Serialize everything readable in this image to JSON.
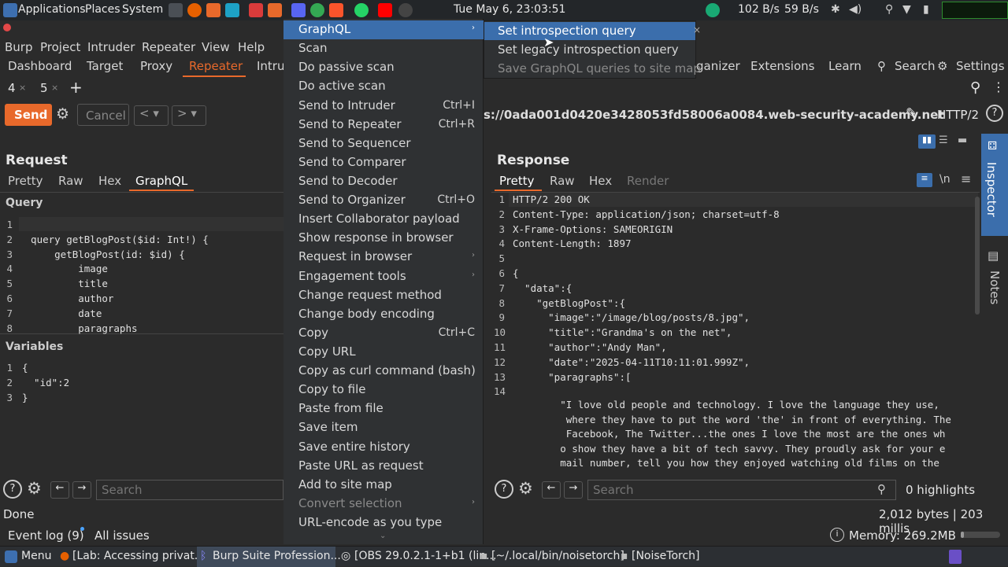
{
  "topbar": {
    "applications": "Applications",
    "places": "Places",
    "system": "System",
    "clock": "Tue May  6, 23:03:51",
    "net_down": "102 B/s",
    "net_up": "59 B/s"
  },
  "menubar": {
    "burp": "Burp",
    "project": "Project",
    "intruder": "Intruder",
    "repeater": "Repeater",
    "view": "View",
    "help": "Help"
  },
  "tabs": {
    "dashboard": "Dashboard",
    "target": "Target",
    "proxy": "Proxy",
    "repeater": "Repeater",
    "intru": "Intru",
    "organizer": "ganizer",
    "extensions": "Extensions",
    "learn": "Learn",
    "search": "Search",
    "settings": "Settings"
  },
  "subtabs": {
    "t4": "4",
    "t5": "5",
    "x": "×",
    "plus": "+"
  },
  "toolbar": {
    "send": "Send",
    "cancel": "Cancel",
    "url": "s://0ada001d0420e3428053fd58006a0084.web-security-academy.net",
    "http": "HTTP/2"
  },
  "request": {
    "title": "Request",
    "tabs": [
      "Pretty",
      "Raw",
      "Hex",
      "GraphQL"
    ],
    "query_label": "Query",
    "variables_label": "Variables",
    "query_lines": [
      "",
      "  query getBlogPost($id: Int!) {",
      "      getBlogPost(id: $id) {",
      "          image",
      "          title",
      "          author",
      "          date",
      "          paragraphs"
    ],
    "var_lines": [
      "{",
      "  \"id\":2",
      "}"
    ]
  },
  "response": {
    "title": "Response",
    "tabs": [
      "Pretty",
      "Raw",
      "Hex",
      "Render"
    ],
    "lines": [
      "HTTP/2 200 OK",
      "Content-Type: application/json; charset=utf-8",
      "X-Frame-Options: SAMEORIGIN",
      "Content-Length: 1897",
      "",
      "{",
      "  \"data\":{",
      "    \"getBlogPost\":{",
      "      \"image\":\"/image/blog/posts/8.jpg\",",
      "      \"title\":\"Grandma's on the net\",",
      "      \"author\":\"Andy Man\",",
      "      \"date\":\"2025-04-11T10:11:01.999Z\",",
      "      \"paragraphs\":[",
      ""
    ],
    "para": [
      "        \"I love old people and technology. I love the language they use,",
      "         where they have to put the word 'the' in front of everything. The",
      "         Facebook, The Twitter...the ones I love the most are the ones wh",
      "        o show they have a bit of tech savvy. They proudly ask for your e",
      "        mail number, tell you how they enjoyed watching old films on the"
    ],
    "highlights": "0 highlights",
    "size": "2,012 bytes | 203 millis"
  },
  "search_placeholder": "Search",
  "status": {
    "done": "Done",
    "event_log": "Event log (9)",
    "all_issues": "All issues",
    "memory": "Memory: 269.2MB"
  },
  "side": {
    "inspector": "Inspector",
    "notes": "Notes"
  },
  "context_menu": {
    "items": [
      {
        "label": "GraphQL",
        "shortcut": "",
        "arrow": true,
        "dim": false,
        "hl": true
      },
      {
        "label": "Scan",
        "shortcut": ""
      },
      {
        "label": "Do passive scan",
        "shortcut": ""
      },
      {
        "label": "Do active scan",
        "shortcut": ""
      },
      {
        "label": "Send to Intruder",
        "shortcut": "Ctrl+I"
      },
      {
        "label": "Send to Repeater",
        "shortcut": "Ctrl+R"
      },
      {
        "label": "Send to Sequencer",
        "shortcut": ""
      },
      {
        "label": "Send to Comparer",
        "shortcut": ""
      },
      {
        "label": "Send to Decoder",
        "shortcut": ""
      },
      {
        "label": "Send to Organizer",
        "shortcut": "Ctrl+O"
      },
      {
        "label": "Insert Collaborator payload",
        "shortcut": ""
      },
      {
        "label": "Show response in browser",
        "shortcut": ""
      },
      {
        "label": "Request in browser",
        "shortcut": "",
        "arrow": true
      },
      {
        "label": "Engagement tools",
        "shortcut": "",
        "arrow": true
      },
      {
        "label": "Change request method",
        "shortcut": ""
      },
      {
        "label": "Change body encoding",
        "shortcut": ""
      },
      {
        "label": "Copy",
        "shortcut": "Ctrl+C"
      },
      {
        "label": "Copy URL",
        "shortcut": ""
      },
      {
        "label": "Copy as curl command (bash)",
        "shortcut": ""
      },
      {
        "label": "Copy to file",
        "shortcut": ""
      },
      {
        "label": "Paste from file",
        "shortcut": ""
      },
      {
        "label": "Save item",
        "shortcut": ""
      },
      {
        "label": "Save entire history",
        "shortcut": ""
      },
      {
        "label": "Paste URL as request",
        "shortcut": ""
      },
      {
        "label": "Add to site map",
        "shortcut": ""
      },
      {
        "label": "Convert selection",
        "shortcut": "",
        "arrow": true,
        "dim": true
      },
      {
        "label": "URL-encode as you type",
        "shortcut": ""
      }
    ]
  },
  "submenu": {
    "items": [
      {
        "label": "Set introspection query",
        "dim": false
      },
      {
        "label": "Set legacy introspection query",
        "dim": false
      },
      {
        "label": "Save GraphQL queries to site map",
        "dim": true
      }
    ]
  },
  "taskbar": {
    "menu": "Menu",
    "items": [
      "[Lab: Accessing privat...",
      "Burp Suite Profession...",
      "[OBS 29.0.2.1-1+b1 (lin...",
      "[~/.local/bin/noisetorch]",
      "[NoiseTorch]"
    ]
  },
  "colors": {
    "accent": "#e8692b",
    "highlight": "#3b6eac",
    "bg": "#2b2b2b"
  }
}
